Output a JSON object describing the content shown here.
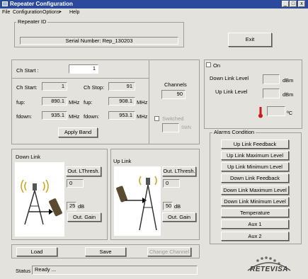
{
  "window": {
    "title": "Repeater Configuration",
    "min": "_",
    "max": "□",
    "close": "x"
  },
  "menu": [
    "File",
    "Configuration",
    "Options",
    "Help"
  ],
  "repeater": {
    "group_label": "Repeater ID",
    "serial": "Serial Number: Rep_130203",
    "exit_label": "Exit"
  },
  "channels": {
    "ch_start_label": "Ch Start :",
    "ch_start_value": "1",
    "ch_start2_label": "Ch Start:",
    "ch_start2_value": "1",
    "ch_stop_label": "Ch Stop:",
    "ch_stop_value": "91",
    "fup_label": "fup:",
    "fup_value": "890.1",
    "fup_unit": "MHz",
    "fup2_label": "fup:",
    "fup2_value": "908.1",
    "fup2_unit": "MHz",
    "fdown_label": "fdown:",
    "fdown_value": "935.1",
    "fdown_unit": "MHz",
    "fdown2_label": "fdown:",
    "fdown2_value": "953.1",
    "fdown2_unit": "MHz",
    "apply_label": "Apply Band",
    "channels_label": "Channels",
    "channels_value": "90",
    "switched_label": "Switched",
    "switched_unit": "SWN"
  },
  "monitor": {
    "on_label": "On",
    "downlink_level_label": "Down Link Level",
    "downlink_unit": "dBm",
    "uplink_level_label": "Up Link Level",
    "uplink_unit": "dBm",
    "temp_unit": "ºC",
    "thermo_color": "#d01818"
  },
  "downlink": {
    "label": "Down Link",
    "thresh_label": "Out. LThresh.",
    "thresh_value": "0",
    "gain_value": "25",
    "gain_unit": "dB",
    "gain_label": "Out. Gain"
  },
  "uplink": {
    "label": "Up Link",
    "thresh_label": "Out. LThresh.",
    "thresh_value": "0",
    "gain_value": "50",
    "gain_unit": "dB",
    "gain_label": "Out. Gain"
  },
  "alarms": {
    "label": "Alarms Condition",
    "items": [
      "Up Link Feedback",
      "Up Link Maximum Level",
      "Up Link Minimum Level",
      "Down Link Feedback",
      "Down Link Maximum Level",
      "Down Link Minimum Level",
      "Temperature",
      "Aux 1",
      "Aux 2"
    ]
  },
  "actions": {
    "load": "Load",
    "save": "Save",
    "change": "Change Channel"
  },
  "status": {
    "label": "Status",
    "value": "Ready ..."
  },
  "logo": {
    "text": "RETEVISA"
  }
}
